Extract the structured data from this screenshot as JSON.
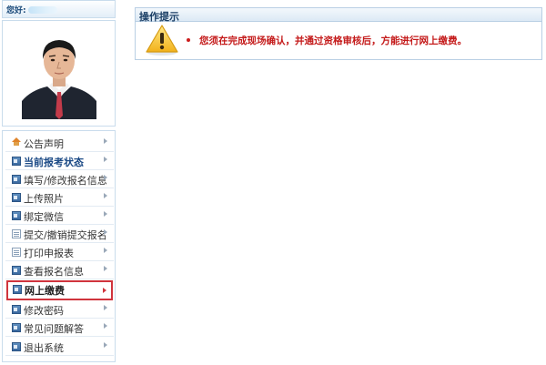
{
  "user": {
    "greeting": "您好:"
  },
  "menu": {
    "items": [
      {
        "label": "公告声明",
        "icon": "house-icon"
      },
      {
        "label": "当前报考状态",
        "icon": "card-icon"
      },
      {
        "label": "填写/修改报名信息",
        "icon": "card-icon"
      },
      {
        "label": "上传照片",
        "icon": "card-icon"
      },
      {
        "label": "绑定微信",
        "icon": "card-icon"
      },
      {
        "label": "提交/撤销提交报名",
        "icon": "document-icon"
      },
      {
        "label": "打印申报表",
        "icon": "document-icon"
      },
      {
        "label": "查看报名信息",
        "icon": "card-icon"
      },
      {
        "label": "网上缴费",
        "icon": "card-icon"
      },
      {
        "label": "修改密码",
        "icon": "card-icon"
      },
      {
        "label": "常见问题解答",
        "icon": "card-icon"
      },
      {
        "label": "退出系统",
        "icon": "card-icon"
      }
    ],
    "active_label": "网上缴费"
  },
  "notice": {
    "title": "操作提示",
    "icon": "warning-icon",
    "message": "您须在完成现场确认，并通过资格审核后，方能进行网上缴费。"
  },
  "colors": {
    "accent": "#d0343d",
    "message": "#c41a1a",
    "border": "#b9cfe4"
  }
}
